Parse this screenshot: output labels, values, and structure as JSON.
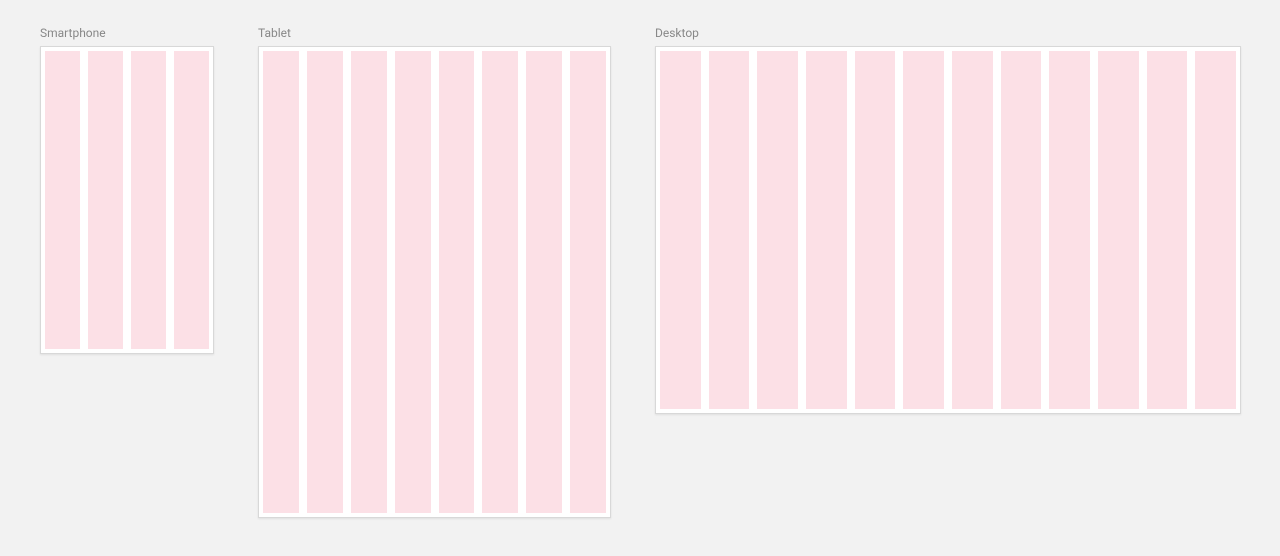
{
  "devices": [
    {
      "label": "Smartphone",
      "columns": 4
    },
    {
      "label": "Tablet",
      "columns": 8
    },
    {
      "label": "Desktop",
      "columns": 12
    }
  ],
  "colors": {
    "column_fill": "#fce0e6",
    "frame_bg": "#ffffff",
    "page_bg": "#f2f2f2"
  }
}
